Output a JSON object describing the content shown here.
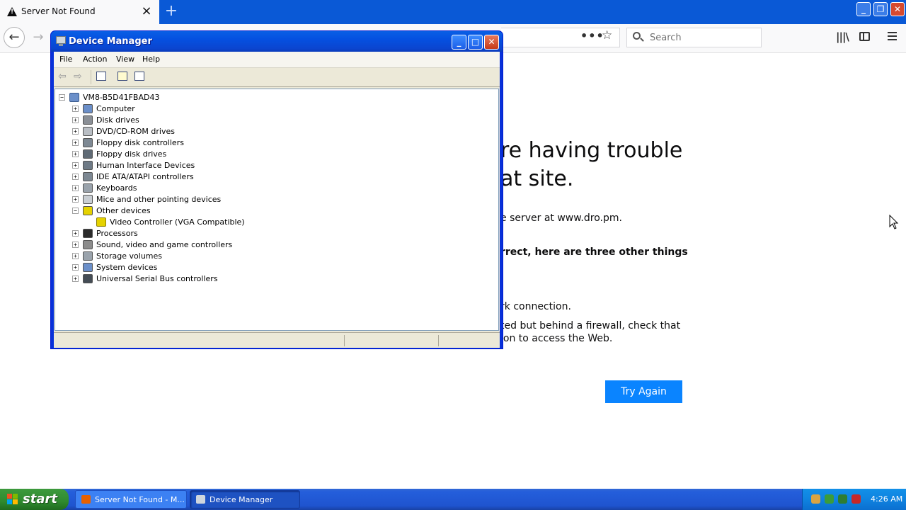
{
  "browser": {
    "tab_title": "Server Not Found",
    "tab_close": "×",
    "new_tab": "+",
    "back_arrow": "←",
    "forward_arrow": "→",
    "page_actions": "•••",
    "bookmark_star": "☆",
    "search_placeholder": "Search",
    "library": "|||\\",
    "window_minimize": "_",
    "window_restore": "❐",
    "window_close": "✕"
  },
  "error_page": {
    "title_line1": "re having trouble",
    "title_line2": "at site.",
    "description": "e server at www.dro.pm.",
    "bold_line": "rrect, here are three other things",
    "tip_1": "rk connection.",
    "tip_2_line1": "ted but behind a firewall, check that",
    "tip_2_line2": "ion to access the Web.",
    "try_again": "Try Again"
  },
  "device_manager": {
    "title": "Device Manager",
    "menu": [
      "File",
      "Action",
      "View",
      "Help"
    ],
    "root": "VM8-B5D41FBAD43",
    "categories": [
      {
        "label": "Computer",
        "expand": "+",
        "icon": "computer-icon",
        "color": "#6b8fc9"
      },
      {
        "label": "Disk drives",
        "expand": "+",
        "icon": "disk-drive-icon",
        "color": "#8a8f96"
      },
      {
        "label": "DVD/CD-ROM drives",
        "expand": "+",
        "icon": "cd-drive-icon",
        "color": "#b9bec4"
      },
      {
        "label": "Floppy disk controllers",
        "expand": "+",
        "icon": "floppy-controller-icon",
        "color": "#7d8893"
      },
      {
        "label": "Floppy disk drives",
        "expand": "+",
        "icon": "floppy-drive-icon",
        "color": "#5f6a75"
      },
      {
        "label": "Human Interface Devices",
        "expand": "+",
        "icon": "hid-icon",
        "color": "#6e7a86"
      },
      {
        "label": "IDE ATA/ATAPI controllers",
        "expand": "+",
        "icon": "ide-controller-icon",
        "color": "#7d8893"
      },
      {
        "label": "Keyboards",
        "expand": "+",
        "icon": "keyboard-icon",
        "color": "#9aa3ac"
      },
      {
        "label": "Mice and other pointing devices",
        "expand": "+",
        "icon": "mouse-icon",
        "color": "#c9ced3"
      },
      {
        "label": "Other devices",
        "expand": "−",
        "icon": "unknown-device-icon",
        "color": "#e5d200"
      },
      {
        "label": "Processors",
        "expand": "+",
        "icon": "processor-icon",
        "color": "#2b2b2b"
      },
      {
        "label": "Sound, video and game controllers",
        "expand": "+",
        "icon": "sound-icon",
        "color": "#8c8c8c"
      },
      {
        "label": "Storage volumes",
        "expand": "+",
        "icon": "storage-volume-icon",
        "color": "#9aa3ac"
      },
      {
        "label": "System devices",
        "expand": "+",
        "icon": "system-device-icon",
        "color": "#6b8fc9"
      },
      {
        "label": "Universal Serial Bus controllers",
        "expand": "+",
        "icon": "usb-icon",
        "color": "#444c55"
      }
    ],
    "child_device": "Video Controller (VGA Compatible)"
  },
  "taskbar": {
    "start_label": "start",
    "tasks": [
      {
        "label": "Server Not Found - M...",
        "icon": "firefox-icon"
      },
      {
        "label": "Device Manager",
        "icon": "device-manager-icon"
      }
    ],
    "clock": "4:26 AM"
  }
}
